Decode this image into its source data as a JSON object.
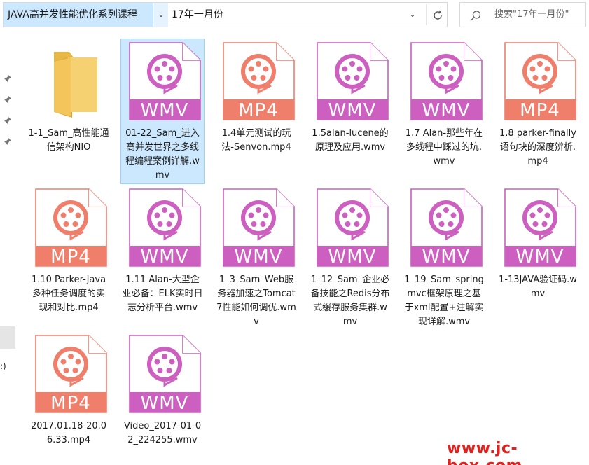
{
  "address_bar": {
    "breadcrumb": "JAVA高并发性能优化系列课程",
    "current_folder": "17年一月份"
  },
  "search": {
    "placeholder": "搜索\"17年一月份\""
  },
  "nav": {
    "partial_label": ":)"
  },
  "colors": {
    "wmv": "#cc5fbf",
    "mp4": "#ef7e6b",
    "folder": "#f6d171",
    "selection": "#cce8ff"
  },
  "files": [
    {
      "name": "1-1_Sam_高性能通信架构NIO",
      "type": "folder",
      "label": ""
    },
    {
      "name": "01-22_Sam_进入高并发世界之多线程编程案例详解.wmv",
      "type": "wmv",
      "label": "WMV",
      "selected": true
    },
    {
      "name": "1.4单元测试的玩法-Senvon.mp4",
      "type": "mp4",
      "label": "MP4"
    },
    {
      "name": "1.5alan-lucene的原理及应用.wmv",
      "type": "wmv",
      "label": "WMV"
    },
    {
      "name": "1.7 Alan-那些年在多线程中踩过的坑.wmv",
      "type": "wmv",
      "label": "WMV"
    },
    {
      "name": "1.8 parker-finally 语句块的深度辨析.mp4",
      "type": "mp4",
      "label": "MP4"
    },
    {
      "name": "1.10 Parker-Java多种任务调度的实现和对比.mp4",
      "type": "mp4",
      "label": "MP4"
    },
    {
      "name": "1.11 Alan-大型企业必备：ELK实时日志分析平台.wmv",
      "type": "wmv",
      "label": "WMV"
    },
    {
      "name": "1_3_Sam_Web服务器加速之Tomcat7性能如何调优.wmv",
      "type": "wmv",
      "label": "WMV"
    },
    {
      "name": "1_12_Sam_企业必备技能之Redis分布式缓存服务集群.wmv",
      "type": "wmv",
      "label": "WMV"
    },
    {
      "name": "1_19_Sam_springmvc框架原理之基于xml配置+注解实现详解.wmv",
      "type": "wmv",
      "label": "WMV"
    },
    {
      "name": "1-13JAVA验证码.wmv",
      "type": "wmv",
      "label": "WMV"
    },
    {
      "name": "2017.01.18-20.06.33.mp4",
      "type": "mp4",
      "label": "MP4"
    },
    {
      "name": "Video_2017-01-02_224255.wmv",
      "type": "wmv",
      "label": "WMV"
    }
  ],
  "watermark": "www.jc-box.com"
}
